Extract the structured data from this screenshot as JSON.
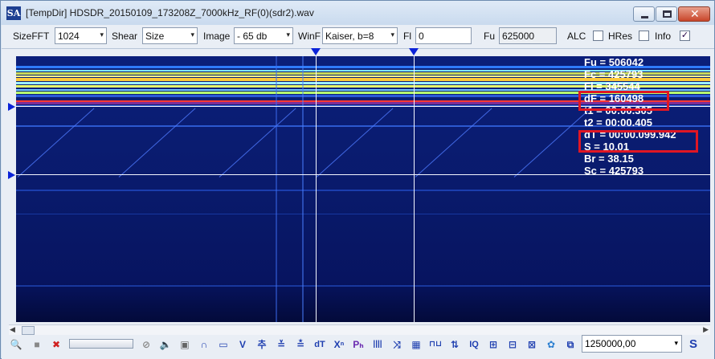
{
  "window": {
    "app_icon": "SA",
    "title": "[TempDir] HDSDR_20150109_173208Z_7000kHz_RF(0)(sdr2).wav",
    "close_glyph": "✕"
  },
  "toolbar": {
    "sizefft_label": "SizeFFT",
    "sizefft_value": "1024",
    "shear_label": "Shear",
    "shear_value": "Size",
    "image_label": "Image",
    "image_value": "- 65 db",
    "winf_label": "WinF",
    "winf_value": "Kaiser, b=8",
    "fl_label": "Fl",
    "fl_value": "0",
    "fu_label": "Fu",
    "fu_value": "625000",
    "alc_label": "ALC",
    "alc_checked": false,
    "hres_label": "HRes",
    "hres_checked": false,
    "info_label": "Info",
    "info_checked": true,
    "check_glyph": "✓",
    "dropdown_glyph": "▾"
  },
  "info_overlay": [
    "Fu = 506042",
    "Fc = 425793",
    "Fl = 345544",
    "dF = 160498",
    "t1 = 00:00.305",
    "t2 = 00:00.405",
    "dT = 00:00.099.942",
    "S = 10.01",
    "Br = 38.15",
    "Sc = 425793"
  ],
  "bottom_toolbar": {
    "frequency_value": "1250000,00",
    "dropdown_glyph": "▾",
    "scroll_left_glyph": "◀",
    "scroll_right_glyph": "▶",
    "icons": [
      {
        "name": "zoom-icon",
        "glyph": "🔍"
      },
      {
        "name": "save-icon",
        "glyph": "■"
      },
      {
        "name": "delete-icon",
        "glyph": "✖"
      },
      {
        "name": "no-icon",
        "glyph": "⊘"
      },
      {
        "name": "speaker-icon",
        "glyph": "🔈"
      },
      {
        "name": "stop-icon",
        "glyph": "▣"
      },
      {
        "name": "arc-icon",
        "glyph": "∩"
      },
      {
        "name": "rectangle-icon",
        "glyph": "▭"
      },
      {
        "name": "v-shape-icon",
        "glyph": "V"
      },
      {
        "name": "up-marker-icon",
        "glyph": "추"
      },
      {
        "name": "down-marker-icon",
        "glyph": "≚"
      },
      {
        "name": "double-marker-icon",
        "glyph": "≛"
      },
      {
        "name": "dt-icon",
        "glyph": "dT"
      },
      {
        "name": "xn-icon",
        "glyph": "Xⁿ"
      },
      {
        "name": "ph-icon",
        "glyph": "Pₕ"
      },
      {
        "name": "bars-icon",
        "glyph": "||||"
      },
      {
        "name": "cross-arrows-icon",
        "glyph": "⤨"
      },
      {
        "name": "table-icon",
        "glyph": "▦"
      },
      {
        "name": "square-wave-icon",
        "glyph": "⊓⊔"
      },
      {
        "name": "updown-icon",
        "glyph": "⇅"
      },
      {
        "name": "iq-icon",
        "glyph": "IQ"
      },
      {
        "name": "pattern-a-icon",
        "glyph": "⊞"
      },
      {
        "name": "pattern-b-icon",
        "glyph": "⊟"
      },
      {
        "name": "pattern-c-icon",
        "glyph": "⊠"
      },
      {
        "name": "gear-icon",
        "glyph": "✿"
      },
      {
        "name": "copy-icon",
        "glyph": "⧉"
      },
      {
        "name": "r-icon",
        "glyph": "R"
      },
      {
        "name": "s-icon",
        "glyph": "S"
      }
    ]
  },
  "colors": {
    "accent_red": "#e01624",
    "marker_blue": "#0a22d8",
    "spectrogram_base": "#0b1f7a"
  }
}
